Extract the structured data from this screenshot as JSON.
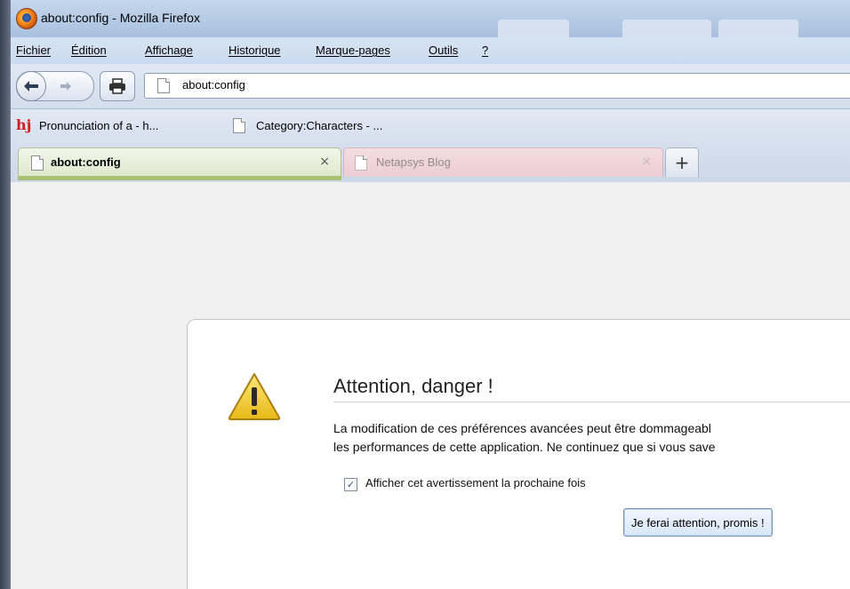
{
  "window": {
    "title": "about:config - Mozilla Firefox"
  },
  "menu": {
    "items": [
      "Fichier",
      "Édition",
      "Affichage",
      "Historique",
      "Marque-pages",
      "Outils",
      "?"
    ]
  },
  "navbar": {
    "url": "about:config"
  },
  "bookmarks": {
    "items": [
      {
        "label": "Pronunciation of a - h...",
        "icon": "hj-icon"
      },
      {
        "label": "Category:Characters - ...",
        "icon": "page-icon"
      }
    ]
  },
  "tabs": [
    {
      "label": "about:config",
      "active": true,
      "close": "×",
      "accent": "#a9c072"
    },
    {
      "label": "Netapsys Blog",
      "active": false,
      "close": "×",
      "accent": "#eccdd4"
    }
  ],
  "new_tab_label": "+",
  "warning": {
    "title": "Attention, danger !",
    "text_line1": "La modification de ces préférences avancées peut être dommageabl",
    "text_line2": "les performances de cette application. Ne continuez que si vous save",
    "checkbox_label": "Afficher cet avertissement la prochaine fois",
    "checkbox_checked": true,
    "button_label": "Je ferai attention, promis !",
    "icon": "warning-triangle-icon"
  },
  "colors": {
    "active_tab_accent": "#a9c072",
    "inactive_tab": "#eccdd4",
    "warning_yellow": "#f5d33b"
  }
}
